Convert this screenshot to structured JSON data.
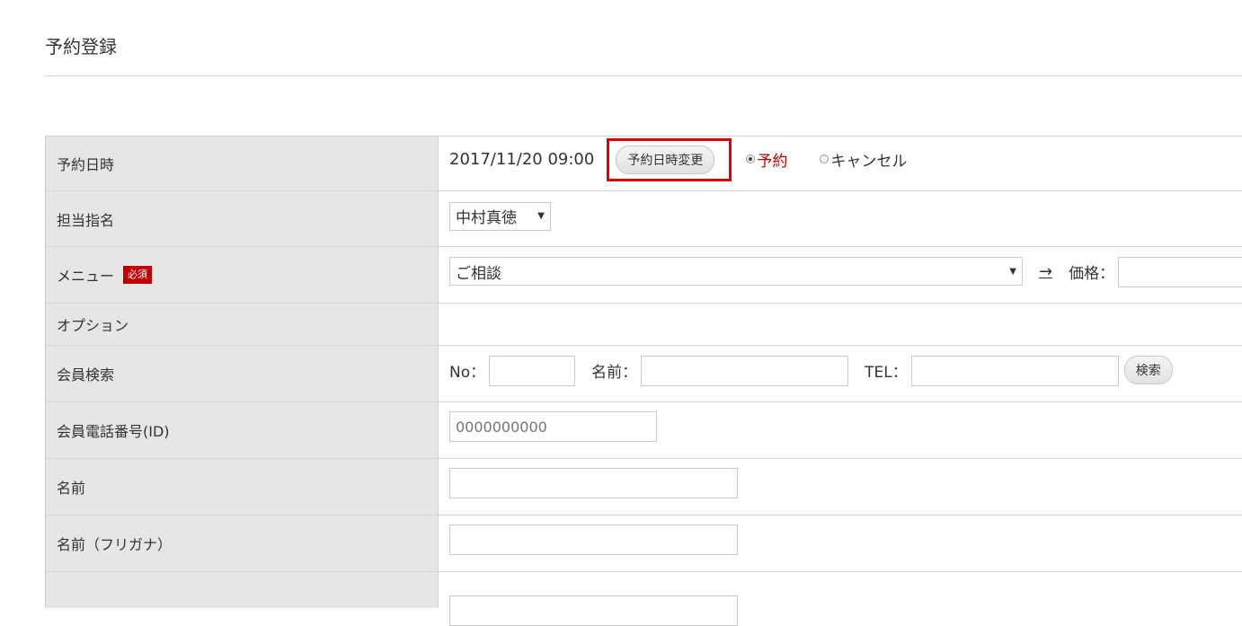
{
  "page": {
    "title": "予約登録"
  },
  "form": {
    "datetime": {
      "label": "予約日時",
      "value": "2017/11/20 09:00",
      "change_button": "予約日時変更",
      "radio_reserve": "予約",
      "radio_cancel": "キャンセル"
    },
    "staff": {
      "label": "担当指名",
      "selected": "中村真徳"
    },
    "menu": {
      "label": "メニュー",
      "required_badge": "必須",
      "selected": "ご相談",
      "arrow": "→",
      "price_label": "価格："
    },
    "option": {
      "label": "オプション"
    },
    "member_search": {
      "label": "会員検索",
      "no_label": "No：",
      "name_label": "名前：",
      "tel_label": "TEL：",
      "search_button": "検索"
    },
    "member_phone": {
      "label": "会員電話番号(ID)",
      "placeholder": "0000000000"
    },
    "name": {
      "label": "名前"
    },
    "name_kana": {
      "label": "名前（フリガナ）"
    }
  },
  "colors": {
    "accent_red": "#c00000",
    "highlight_box": "#e00000",
    "label_bg": "#e6e6e6"
  }
}
